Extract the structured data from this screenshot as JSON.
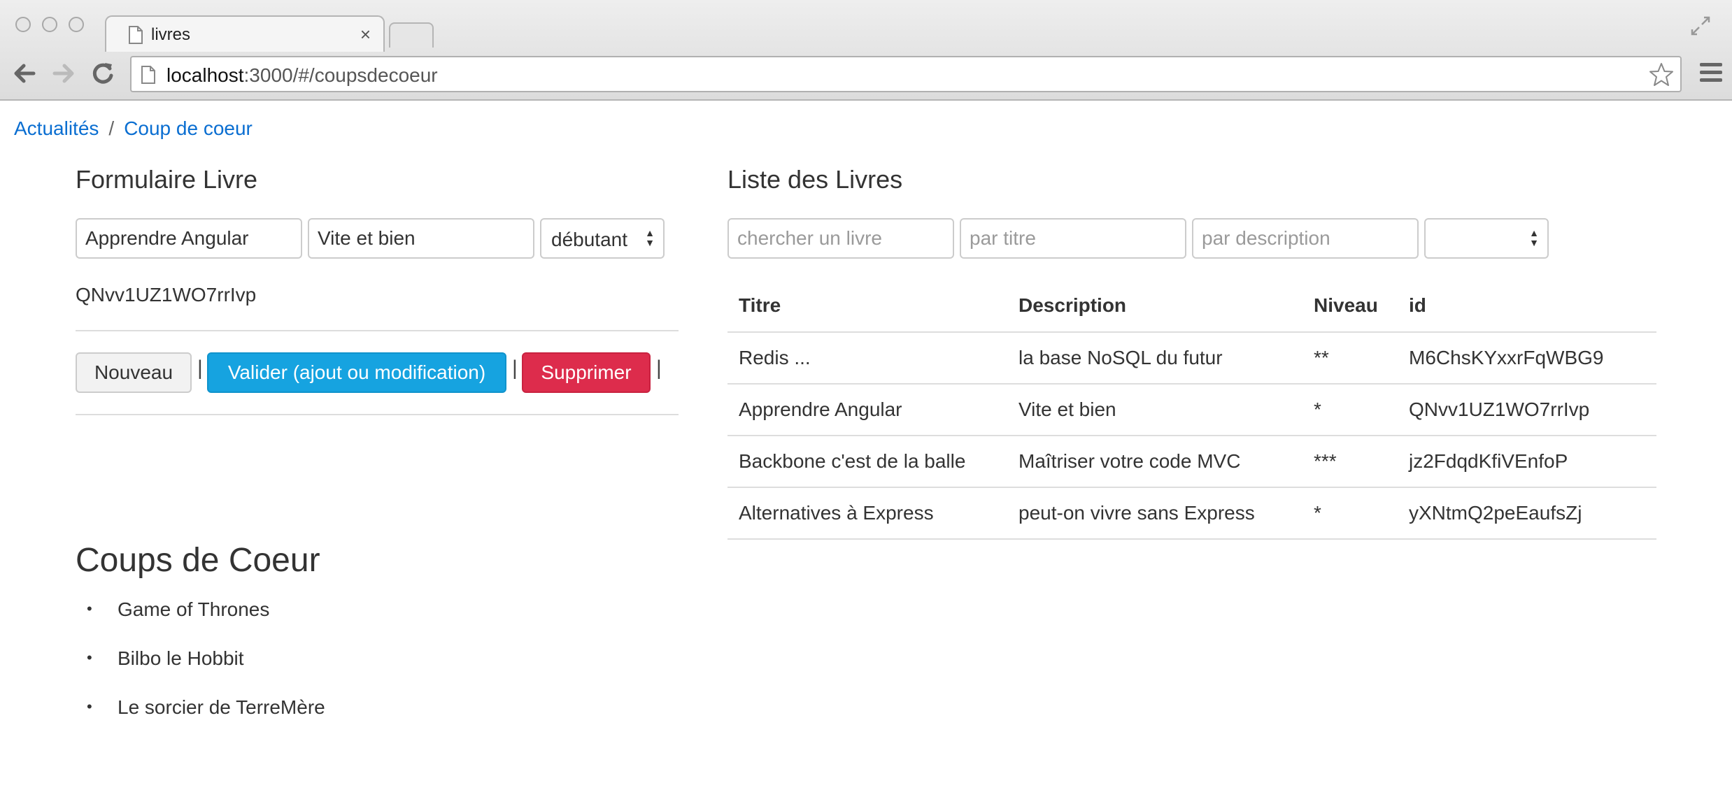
{
  "browser": {
    "tab_title": "livres",
    "url_host": "localhost",
    "url_rest": ":3000/#/coupsdecoeur"
  },
  "breadcrumb": {
    "items": [
      "Actualités",
      "Coup de coeur"
    ],
    "separator": "/"
  },
  "form": {
    "title": "Formulaire Livre",
    "titre_value": "Apprendre Angular",
    "description_value": "Vite et bien",
    "niveau_value": "débutant",
    "id_text": "QNvv1UZ1WO7rrIvp",
    "buttons": {
      "new": "Nouveau",
      "validate": "Valider (ajout ou modification)",
      "delete": "Supprimer"
    },
    "separator": "|"
  },
  "list": {
    "title": "Liste des Livres",
    "search_placeholder": "chercher un livre",
    "titre_placeholder": "par titre",
    "description_placeholder": "par description",
    "niveau_filter_value": "",
    "columns": [
      "Titre",
      "Description",
      "Niveau",
      "id"
    ],
    "rows": [
      [
        "Redis ...",
        "la base NoSQL du futur",
        "**",
        "M6ChsKYxxrFqWBG9"
      ],
      [
        "Apprendre Angular",
        "Vite et bien",
        "*",
        "QNvv1UZ1WO7rrIvp"
      ],
      [
        "Backbone c'est de la balle",
        "Maîtriser votre code MVC",
        "***",
        "jz2FdqdKfiVEnfoP"
      ],
      [
        "Alternatives à Express",
        "peut-on vivre sans Express",
        "*",
        "yXNtmQ2peEaufsZj"
      ]
    ]
  },
  "coups": {
    "title": "Coups de Coeur",
    "bullet": "•",
    "items": [
      "Game of Thrones",
      "Bilbo le Hobbit",
      "Le sorcier de TerreMère"
    ]
  },
  "colors": {
    "link": "#0a6ed1",
    "primary": "#16a3e0",
    "danger": "#dd2c4c"
  }
}
